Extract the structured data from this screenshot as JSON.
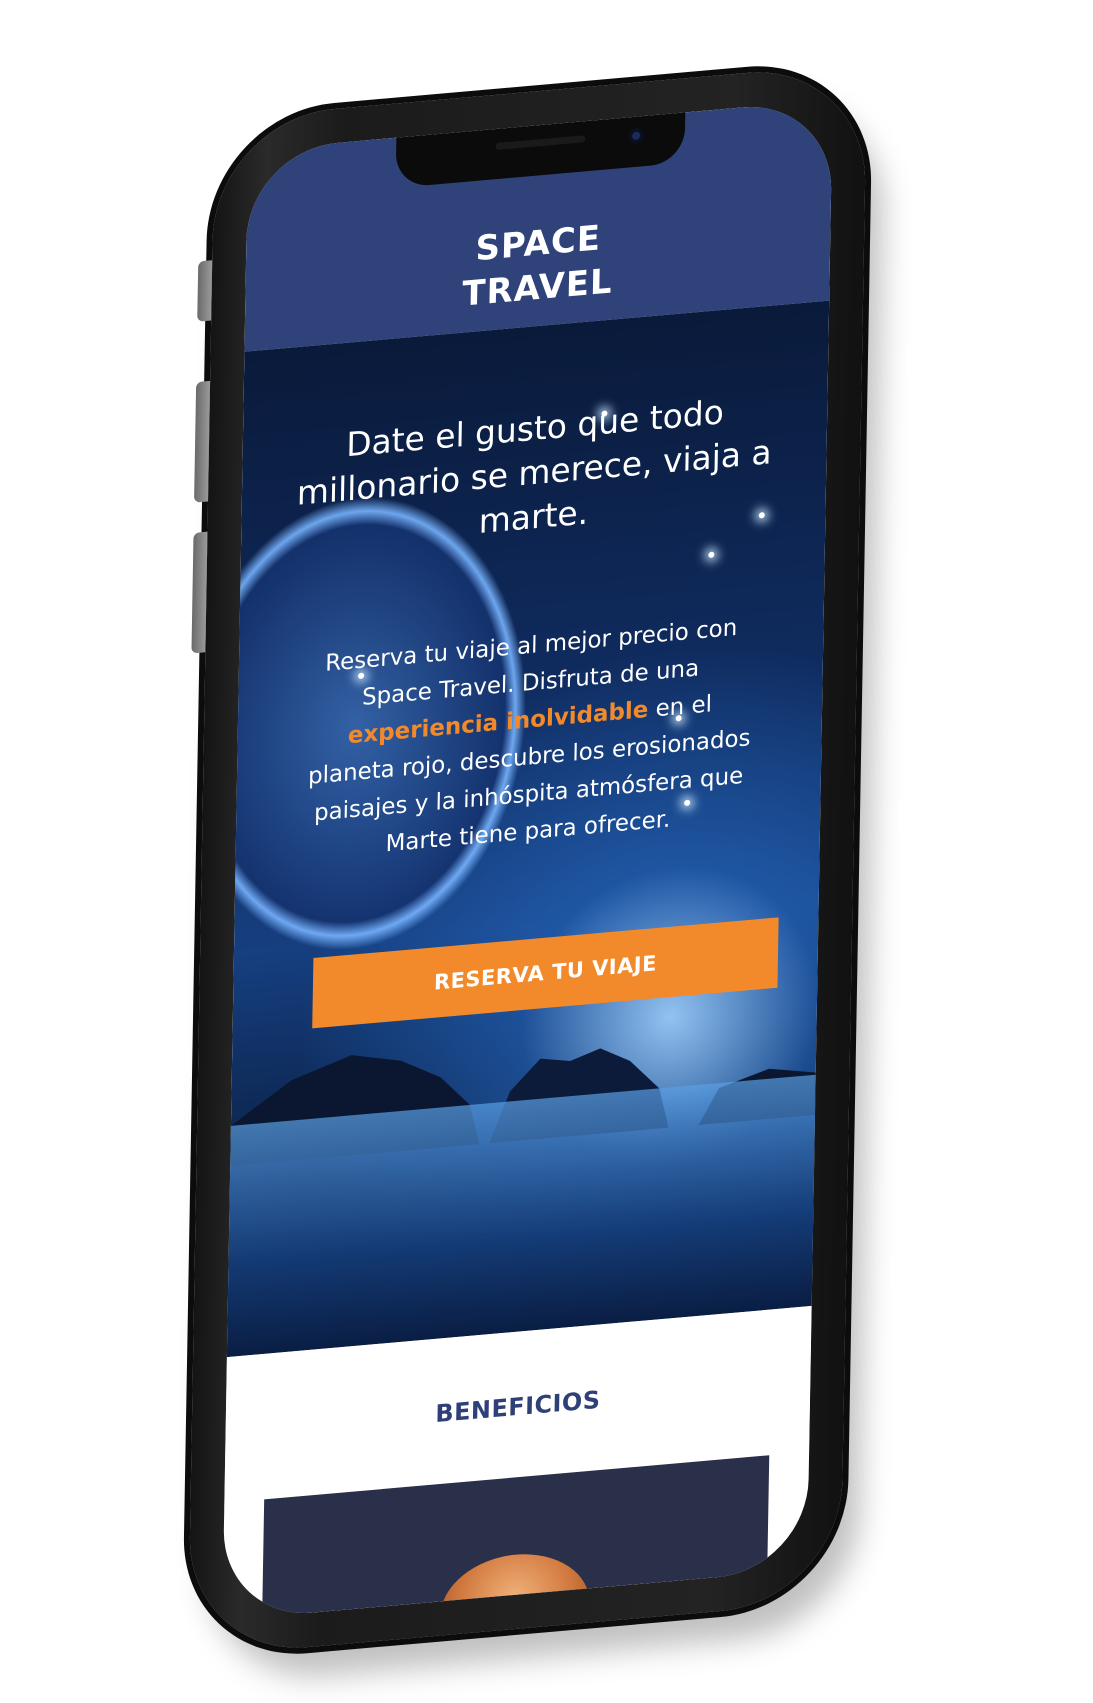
{
  "header": {
    "brand_line1": "SPACE",
    "brand_line2": "TRAVEL"
  },
  "hero": {
    "headline": "Date el gusto que todo millonario se merece, viaja a marte.",
    "body_before": "Reserva tu viaje al mejor precio con Space Travel. Disfruta de una ",
    "body_highlight": "experiencia inolvidable",
    "body_after": " en el planeta rojo, descubre los erosionados paisajes y la inhóspita atmósfera que Marte tiene para ofrecer.",
    "cta_label": "RESERVA TU VIAJE"
  },
  "benefits": {
    "title": "BENEFICIOS"
  },
  "colors": {
    "header_bg": "#2f437a",
    "accent_orange": "#f28a2c",
    "section_title": "#2f3f78",
    "phone_frame": "#1b1b1b"
  },
  "icons": {
    "camera": "front-camera-icon"
  }
}
